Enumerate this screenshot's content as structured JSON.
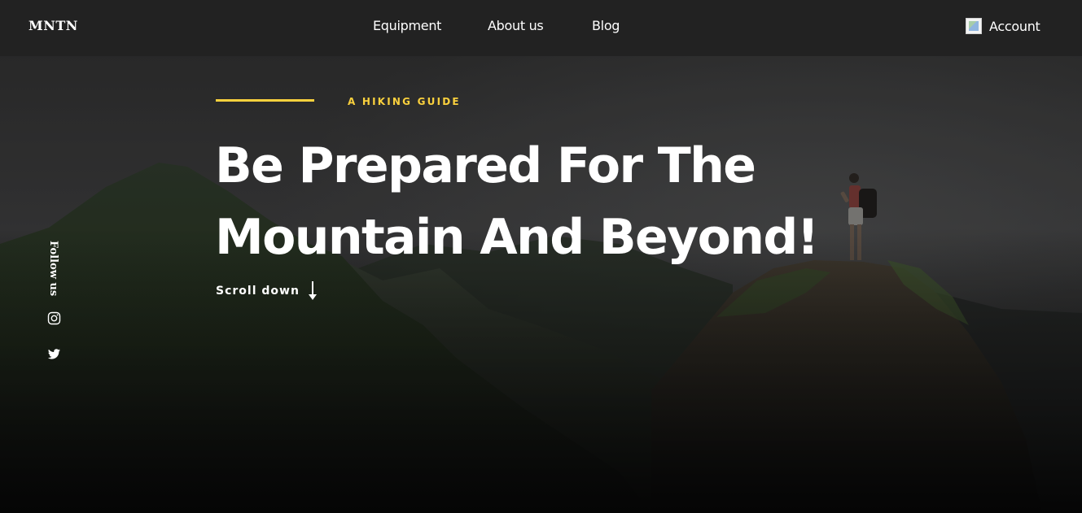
{
  "brand": {
    "logo": "MNTN"
  },
  "nav": {
    "items": [
      {
        "label": "Equipment"
      },
      {
        "label": "About us"
      },
      {
        "label": "Blog"
      }
    ],
    "account": {
      "label": "Account",
      "icon": "user-avatar-icon"
    }
  },
  "hero": {
    "eyebrow": "A HIKING GUIDE",
    "headline_line1": "Be Prepared For The",
    "headline_line2": "Mountain And Beyond!",
    "scroll_label": "Scroll down",
    "scroll_icon": "arrow-down-icon"
  },
  "sidebar": {
    "follow_label": "Follow us",
    "socials": [
      {
        "icon": "instagram-icon"
      },
      {
        "icon": "twitter-icon"
      }
    ]
  },
  "colors": {
    "accent": "#fbd13d",
    "header_bg": "#222222",
    "text": "#ffffff",
    "page_bottom": "#0b0b0b"
  }
}
